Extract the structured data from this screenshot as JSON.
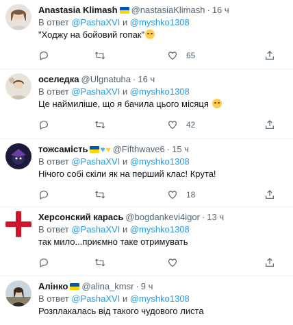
{
  "tweets": [
    {
      "name": "Anastasia Klimash",
      "flags": "ua",
      "handle": "@nastasiaKlimash",
      "time": "16 ч",
      "reply_prefix": "В ответ",
      "reply_user1": "@PashaXVI",
      "reply_and": "и",
      "reply_user2": "@myshko1308",
      "text": "\"Ходжу на бойовий гопак\"",
      "emoji": "smiling-face-with-smiling-eyes",
      "likes": "65"
    },
    {
      "name": "оселедка",
      "handle": "@Ulgnatuha",
      "time": "16 ч",
      "reply_prefix": "В ответ",
      "reply_user1": "@PashaXVI",
      "reply_and": "и",
      "reply_user2": "@myshko1308",
      "text": "Це наймиліше, що я бачила цього місяця",
      "emoji": "pleading-face",
      "likes": "42"
    },
    {
      "name": "тожсамість",
      "handle": "@Fifthwave6",
      "time": "15 ч",
      "reply_prefix": "В ответ",
      "reply_user1": "@PashaXVI",
      "reply_and": "и",
      "reply_user2": "@myshko1308",
      "text": "Нічого собі скіли як на перший клас! Крута!",
      "likes": "18"
    },
    {
      "name": "Херсонский карась",
      "handle": "@bogdankevi4igor",
      "time": "13 ч",
      "reply_prefix": "В ответ",
      "reply_user1": "@PashaXVI",
      "reply_and": "и",
      "reply_user2": "@myshko1308",
      "text": "так мило...приємно таке отримувать",
      "likes": ""
    },
    {
      "name": "Алінко",
      "handle": "@alina_kmsr",
      "time": "9 ч",
      "reply_prefix": "В ответ",
      "reply_user1": "@PashaXVI",
      "reply_and": "и",
      "reply_user2": "@myshko1308",
      "text": "Розплакалась від такого чудового листа",
      "likes": ""
    }
  ],
  "colors": {
    "link": "#1d9bf0",
    "muted": "#536471",
    "text": "#0f1419",
    "ua_blue": "#0057b7",
    "ua_yellow": "#ffd700"
  }
}
